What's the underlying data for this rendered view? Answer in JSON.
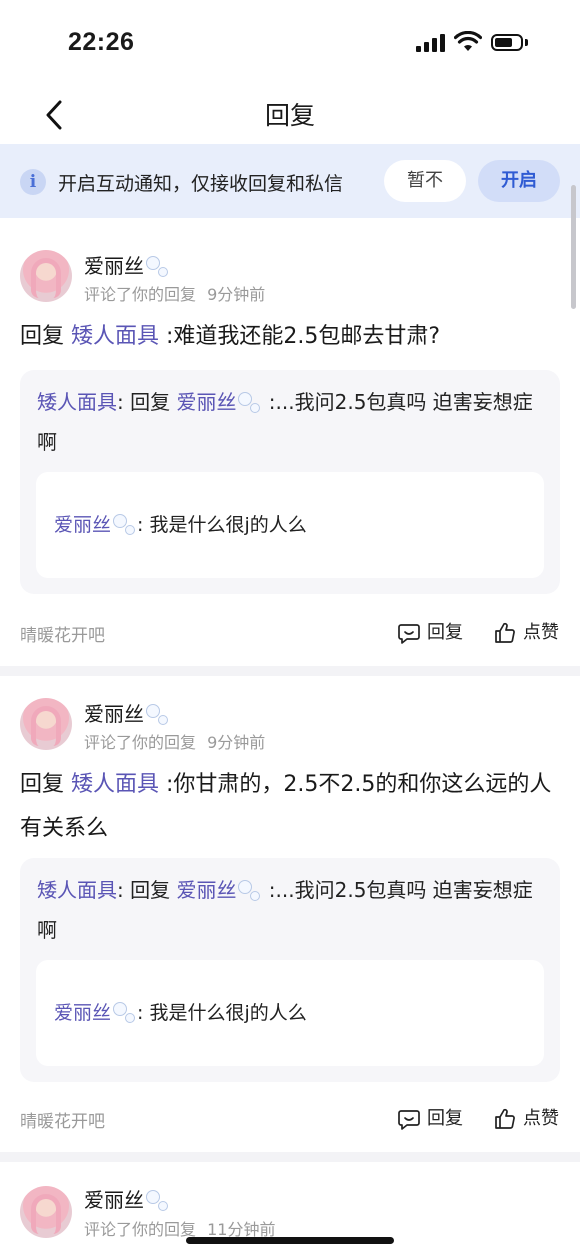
{
  "status_bar": {
    "time": "22:26"
  },
  "nav": {
    "title": "回复"
  },
  "banner": {
    "text": "开启互动通知，仅接收回复和私信",
    "later_label": "暂不",
    "enable_label": "开启",
    "info_glyph": "i"
  },
  "colors": {
    "accent": "#5a55b5",
    "banner_bg": "#e8eefb",
    "enable_text": "#2f5bd3"
  },
  "items": [
    {
      "username": "爱丽丝",
      "action": "评论了你的回复",
      "time": "9分钟前",
      "reply_prefix": "回复 ",
      "reply_mention": "矮人面具",
      "reply_body": " :难道我还能2.5包邮去甘肃?",
      "quote_user": "矮人面具",
      "quote_mid": ": 回复 ",
      "quote_mention": "爱丽丝",
      "quote_body": " :...我问2.5包真吗 迫害妄想症啊",
      "inner_user": "爱丽丝",
      "inner_body": ": 我是什么很j的人么",
      "source": "晴暖花开吧",
      "reply_label": "回复",
      "like_label": "点赞"
    },
    {
      "username": "爱丽丝",
      "action": "评论了你的回复",
      "time": "9分钟前",
      "reply_prefix": "回复 ",
      "reply_mention": "矮人面具",
      "reply_body": " :你甘肃的，2.5不2.5的和你这么远的人有关系么",
      "quote_user": "矮人面具",
      "quote_mid": ": 回复 ",
      "quote_mention": "爱丽丝",
      "quote_body": " :...我问2.5包真吗 迫害妄想症啊",
      "inner_user": "爱丽丝",
      "inner_body": ": 我是什么很j的人么",
      "source": "晴暖花开吧",
      "reply_label": "回复",
      "like_label": "点赞"
    },
    {
      "username": "爱丽丝",
      "action": "评论了你的回复",
      "time": "11分钟前"
    }
  ]
}
